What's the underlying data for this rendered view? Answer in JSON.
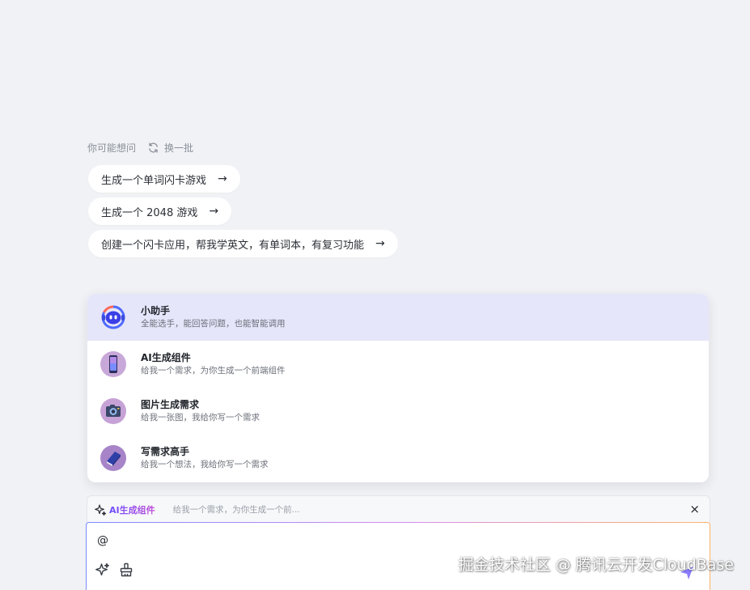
{
  "suggestions": {
    "hint_label": "你可能想问",
    "refresh_label": "换一批",
    "items": [
      {
        "text": "生成一个单词闪卡游戏",
        "arrow": "→"
      },
      {
        "text": "生成一个 2048 游戏",
        "arrow": "→"
      },
      {
        "text": "创建一个闪卡应用，帮我学英文，有单词本，有复习功能",
        "arrow": "→"
      }
    ]
  },
  "agents": [
    {
      "name": "小助手",
      "desc": "全能选手，能回答问题，也能智能调用",
      "icon": "robot-icon",
      "active": true
    },
    {
      "name": "AI生成组件",
      "desc": "给我一个需求，为你生成一个前端组件",
      "icon": "phone-icon",
      "active": false
    },
    {
      "name": "图片生成需求",
      "desc": "给我一张图，我给你写一个需求",
      "icon": "camera-icon",
      "active": false
    },
    {
      "name": "写需求高手",
      "desc": "给我一个想法，我给你写一个需求",
      "icon": "book-icon",
      "active": false
    }
  ],
  "selected_agent": {
    "name": "AI生成组件",
    "desc": "给我一个需求，为你生成一个前...",
    "close": "×"
  },
  "input": {
    "value": "@"
  },
  "watermark": "掘金技术社区 @ 腾讯云开发CloudBase",
  "colors": {
    "background": "#f1f2f5",
    "active_agent_bg": "#e6e6fa",
    "accent_gradient_start": "#6a4dff",
    "accent_gradient_end": "#c04bd6"
  }
}
